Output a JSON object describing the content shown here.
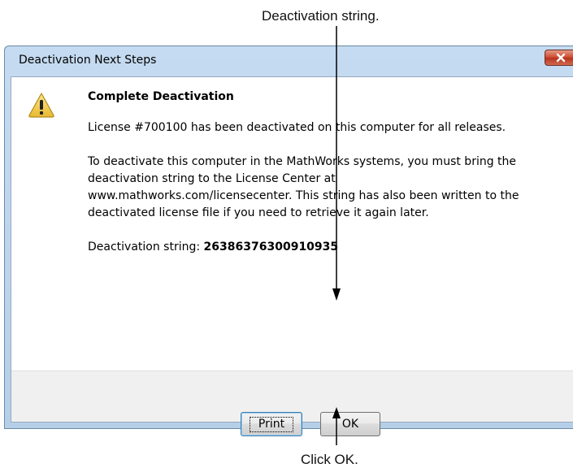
{
  "callouts": {
    "top": "Deactivation string.",
    "bottom": "Click OK."
  },
  "window": {
    "title": "Deactivation Next Steps"
  },
  "icon": "warning-icon",
  "content": {
    "heading": "Complete Deactivation",
    "paragraph1": "License #700100 has been deactivated on this computer for all releases.",
    "paragraph2": "To deactivate this computer in the MathWorks systems, you must bring the deactivation string to the License Center at www.mathworks.com/licensecenter. This string has also been written to the deactivated license file if you need to retrieve it again later.",
    "deactivation_label": "Deactivation string:",
    "deactivation_value": "26386376300910935"
  },
  "buttons": {
    "print": "Print",
    "ok": "OK"
  }
}
